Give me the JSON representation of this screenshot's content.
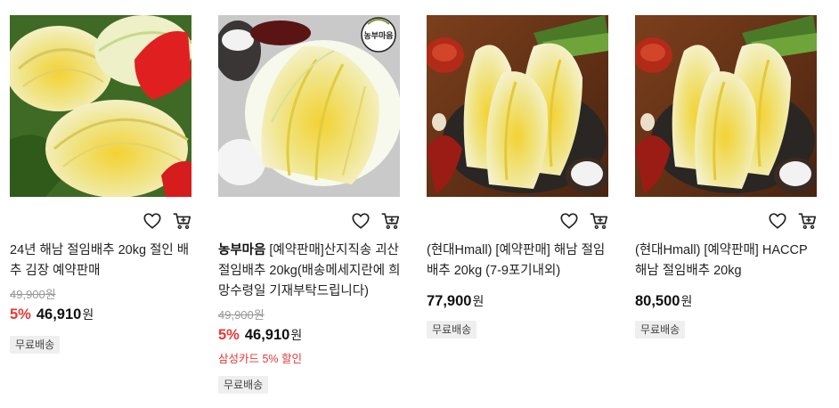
{
  "products": [
    {
      "title": "24년 해남 절임배추 20kg 절인 배추 김장 예약판매",
      "original_price": "49,900원",
      "discount": "5%",
      "price": "46,910",
      "currency": "원",
      "tag": "무료배송"
    },
    {
      "brand": "농부마음",
      "title": " [예약판매]산지직송 괴산 절임배추 20kg(배송메세지란에 희망수령일 기재부탁드립니다)",
      "original_price": "49,900원",
      "discount": "5%",
      "price": "46,910",
      "currency": "원",
      "promo": "삼성카드 5% 할인",
      "tag": "무료배송",
      "logo_text": "농부마음"
    },
    {
      "title": "(현대Hmall) [예약판매] 해남 절임배추 20kg (7-9포기내외)",
      "price": "77,900",
      "currency": "원",
      "tag": "무료배송"
    },
    {
      "title": "(현대Hmall) [예약판매] HACCP 해남 절임배추 20kg",
      "price": "80,500",
      "currency": "원",
      "tag": "무료배송"
    }
  ],
  "icons": {
    "wishlist": "heart-icon",
    "cart": "cart-icon"
  },
  "colors": {
    "discount": "#e53935",
    "tag_bg": "#efefef",
    "original_price": "#999999"
  }
}
